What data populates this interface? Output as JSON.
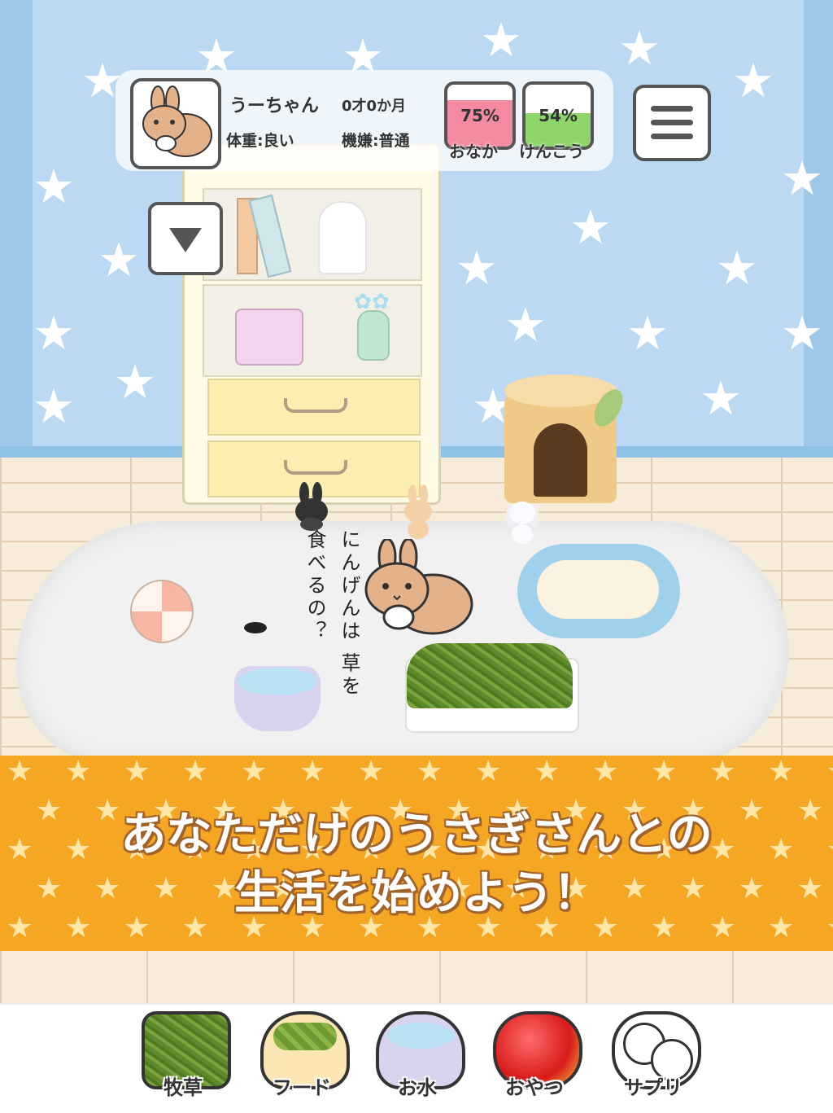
{
  "pet": {
    "name": "うーちゃん",
    "age": "0才0か月",
    "weight": "体重:良い",
    "mood": "機嫌:普通"
  },
  "meters": [
    {
      "value": "75%",
      "label": "おなか",
      "fill": 0.75,
      "color": "#f48aa0"
    },
    {
      "value": "54%",
      "label": "けんこう",
      "fill": 0.54,
      "color": "#8fd66a"
    }
  ],
  "speech": "にんげんは 草を食べるの？",
  "banner": {
    "line1": "あなただけのうさぎさんとの",
    "line2": "生活を始めよう！",
    "color": "#f5a623"
  },
  "toolbar": [
    {
      "label": "牧草",
      "icon": "hay-icon"
    },
    {
      "label": "フード",
      "icon": "food-bowl-icon"
    },
    {
      "label": "お水",
      "icon": "water-bowl-icon"
    },
    {
      "label": "おやつ",
      "icon": "apple-icon"
    },
    {
      "label": "サプリ",
      "icon": "supplement-icon"
    }
  ]
}
